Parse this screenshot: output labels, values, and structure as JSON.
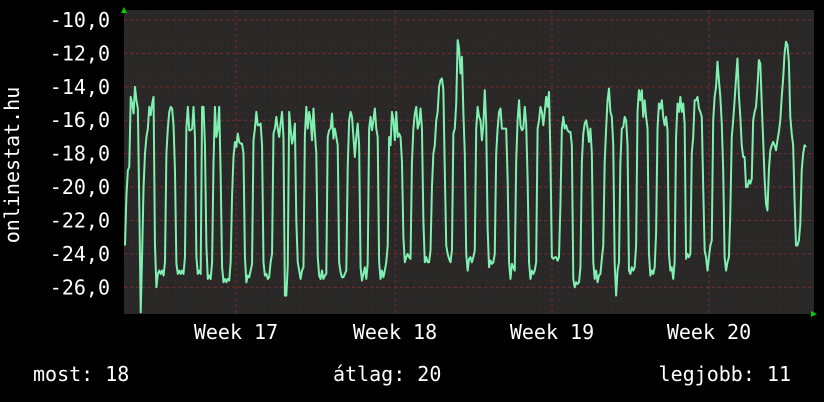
{
  "chart_data": {
    "type": "line",
    "ylabel": "onlinestat.hu",
    "y_ticks": [
      "-10,0",
      "-12,0",
      "-14,0",
      "-16,0",
      "-18,0",
      "-20,0",
      "-22,0",
      "-24,0",
      "-26,0"
    ],
    "ylim": [
      -27.6,
      -9.4
    ],
    "x_ticks": [
      "Week 17",
      "Week 18",
      "Week 19",
      "Week 20"
    ],
    "grid": true,
    "colors": {
      "line": "#7ff0b0",
      "plot_background": "#282828",
      "grid": "#5a2a2a",
      "axis_arrow": "#00cc00"
    },
    "series": [
      {
        "values": [
          -23.5,
          -20.5,
          -19,
          -18.8,
          -14.6,
          -15,
          -15.6,
          -14,
          -14.8,
          -15.3,
          -21,
          -27.5,
          -24,
          -20,
          -18,
          -17,
          -16.5,
          -15.2,
          -15.7,
          -15,
          -14.6,
          -23.5,
          -26,
          -25.2,
          -25,
          -25.2,
          -25,
          -25.3,
          -24.5,
          -18,
          -16.5,
          -15.5,
          -15.2,
          -15.3,
          -16.3,
          -19,
          -24.6,
          -25.2,
          -25,
          -25.2,
          -25,
          -25.2,
          -24.2,
          -16.5,
          -15.2,
          -16.6,
          -16.6,
          -16.5,
          -15.2,
          -17,
          -24.2,
          -25.2,
          -25,
          -25.2,
          -15.2,
          -15.2,
          -17.5,
          -23.5,
          -25.5,
          -25.3,
          -25.5,
          -24.5,
          -18.5,
          -15.2,
          -17,
          -16.5,
          -15.2,
          -19.2,
          -24.8,
          -25.7,
          -25.5,
          -25.7,
          -25.5,
          -25.6,
          -24.5,
          -20.5,
          -18.2,
          -17.3,
          -17.6,
          -16.8,
          -17.3,
          -17.4,
          -17.4,
          -18,
          -24.2,
          -25.7,
          -25.3,
          -25.4,
          -25,
          -24.6,
          -17.2,
          -16.5,
          -15.5,
          -16.3,
          -16.3,
          -16.2,
          -17.5,
          -24.5,
          -25.3,
          -25.2,
          -25.5,
          -25.4,
          -24.5,
          -24,
          -16.8,
          -16.5,
          -15.8,
          -16.5,
          -17,
          -16.2,
          -15.5,
          -17,
          -26.5,
          -26.5,
          -24.7,
          -15.5,
          -16.5,
          -17.4,
          -17,
          -16.2,
          -22,
          -24.5,
          -25,
          -25.5,
          -25,
          -24.8,
          -16.9,
          -15.2,
          -16.5,
          -15.5,
          -16,
          -17.2,
          -15.3,
          -16.8,
          -18,
          -24.2,
          -25.3,
          -25.5,
          -25,
          -25.5,
          -25.3,
          -25.2,
          -17,
          -16.6,
          -16.5,
          -15.6,
          -17.1,
          -16.5,
          -17,
          -17.5,
          -24.5,
          -25.1,
          -25.4,
          -25.4,
          -25.2,
          -25,
          -18.8,
          -16,
          -15.5,
          -15.8,
          -17,
          -18.2,
          -17,
          -16.2,
          -17.5,
          -24.8,
          -25.6,
          -25.2,
          -24.8,
          -25.5,
          -24.6,
          -16.5,
          -15.8,
          -16.6,
          -16,
          -15.3,
          -16.5,
          -17,
          -24.5,
          -25.5,
          -25,
          -25.4,
          -25,
          -24.5,
          -23.5,
          -17,
          -17.5,
          -15.5,
          -16,
          -17.2,
          -15.5,
          -17,
          -16.8,
          -17,
          -18.5,
          -23,
          -24.5,
          -24.2,
          -24,
          -24.2,
          -24.3,
          -18.5,
          -16.5,
          -15.6,
          -15.2,
          -16.5,
          -16.2,
          -15.3,
          -16.5,
          -22,
          -24.5,
          -24.2,
          -24.5,
          -24.5,
          -23.8,
          -20,
          -18,
          -17.5,
          -16,
          -15.5,
          -14,
          -13.6,
          -13.5,
          -14.2,
          -19,
          -23.5,
          -24,
          -24.3,
          -24.5,
          -23.8,
          -16.8,
          -16.5,
          -15,
          -11.2,
          -11.7,
          -13.2,
          -12.2,
          -15.5,
          -18,
          -24,
          -25,
          -24.3,
          -24.2,
          -24.5,
          -24.2,
          -23.8,
          -16.5,
          -15.2,
          -15.8,
          -16,
          -17.2,
          -16.3,
          -14.2,
          -16.2,
          -22.5,
          -24.8,
          -24.4,
          -24.6,
          -24.5,
          -24,
          -18,
          -16.5,
          -15.5,
          -15.3,
          -16.5,
          -16.5,
          -16.5,
          -16.5,
          -19.5,
          -24.5,
          -25.5,
          -24.6,
          -24.8,
          -25,
          -18.5,
          -16,
          -14.8,
          -16.3,
          -16.6,
          -16.5,
          -15.2,
          -16.2,
          -19.5,
          -24.5,
          -25.5,
          -25,
          -25.2,
          -25,
          -24.5,
          -16.5,
          -16,
          -15.2,
          -15.5,
          -16.3,
          -15.5,
          -14.6,
          -15.2,
          -14.3,
          -18.2,
          -24.2,
          -24.3,
          -24.2,
          -24.2,
          -24.4,
          -24.2,
          -21,
          -16.5,
          -15.8,
          -16.5,
          -16.3,
          -16.6,
          -16.7,
          -16.7,
          -17.5,
          -25.5,
          -26,
          -25.7,
          -25.8,
          -25.7,
          -24.8,
          -18.5,
          -16.8,
          -16.2,
          -16,
          -16.5,
          -17.3,
          -16.5,
          -18,
          -24.5,
          -25.5,
          -25,
          -25.7,
          -25.3,
          -25.2,
          -24.3,
          -23.5,
          -18.5,
          -16.5,
          -14.8,
          -14.1,
          -15.5,
          -15.8,
          -17.5,
          -24.6,
          -26.5,
          -25,
          -24.5,
          -18.5,
          -16.5,
          -16.4,
          -15.8,
          -16,
          -17.5,
          -25,
          -25.2,
          -24.8,
          -25,
          -24.8,
          -23.5,
          -15.5,
          -14.2,
          -14.8,
          -14.2,
          -15.8,
          -14.8,
          -15.8,
          -16.5,
          -24,
          -25.3,
          -25,
          -25.2,
          -24.8,
          -22.8,
          -16.5,
          -15,
          -15.3,
          -14.8,
          -15.8,
          -16.3,
          -15.8,
          -16.6,
          -24,
          -25,
          -24.8,
          -25.5,
          -24.5,
          -17,
          -15,
          -15.5,
          -14.6,
          -15.5,
          -15,
          -16.2,
          -24.3,
          -24,
          -24.2,
          -24,
          -18,
          -17,
          -14.8,
          -14.8,
          -14.6,
          -15.3,
          -15.5,
          -15.8,
          -20,
          -23.8,
          -24.2,
          -25,
          -24.2,
          -23.5,
          -23.2,
          -16,
          -14.6,
          -14,
          -12.5,
          -13.6,
          -14.6,
          -16.2,
          -19,
          -24.2,
          -25,
          -24.5,
          -24.2,
          -21.5,
          -17,
          -16,
          -14.8,
          -13.5,
          -12.3,
          -14.5,
          -15.8,
          -17.5,
          -18.2,
          -18.2,
          -20,
          -20,
          -19.6,
          -19.8,
          -19.5,
          -16,
          -15.5,
          -15.2,
          -14,
          -12.4,
          -12.6,
          -15,
          -17.2,
          -19.5,
          -21,
          -21.4,
          -19,
          -17.8,
          -17.5,
          -17.3,
          -17.5,
          -17.8,
          -17.2,
          -16.7,
          -16,
          -14.6,
          -13.5,
          -12,
          -11.3,
          -11.5,
          -12.5,
          -15.8,
          -16.8,
          -17.5,
          -20.8,
          -23.5,
          -23.5,
          -23.2,
          -22.2,
          -19,
          -18,
          -17.5,
          -17.6
        ]
      }
    ]
  },
  "footer": {
    "current": "most: 18",
    "average": "átlag: 20",
    "best": "legjobb: 11"
  }
}
